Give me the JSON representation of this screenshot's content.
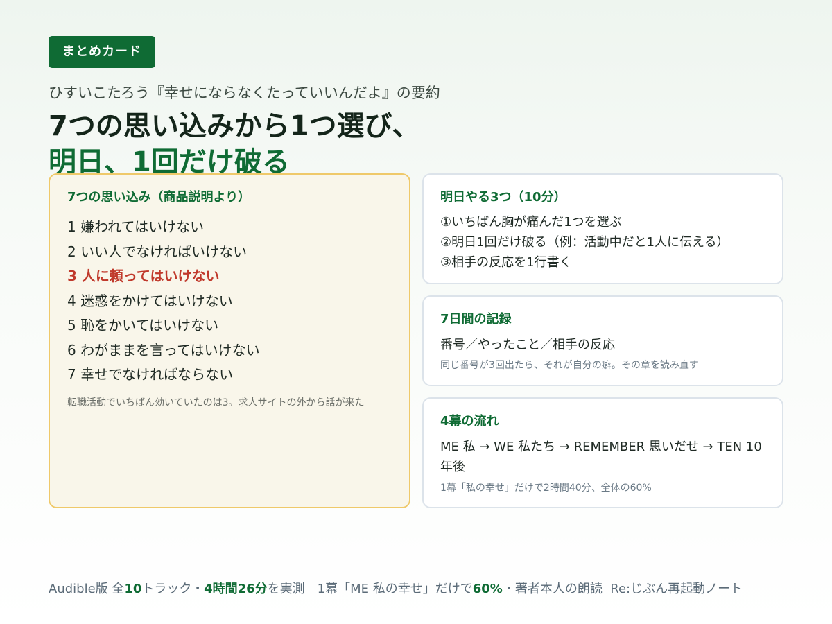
{
  "badge": "まとめカード",
  "subtitle": "ひすいこたろう『幸せにならなくたっていいんだよ』の要約",
  "title": {
    "line1": "7つの思い込みから1つ選び、",
    "line2": "明日、1回だけ破る"
  },
  "beliefs_card": {
    "heading": "7つの思い込み（商品説明より）",
    "items": [
      "1 嫌われてはいけない",
      "2 いい人でなければいけない",
      "3 人に頼ってはいけない",
      "4 迷惑をかけてはいけない",
      "5 恥をかいてはいけない",
      "6 わがままを言ってはいけない",
      "7 幸せでなければならない"
    ],
    "highlighted_item": "3 人に頼ってはいけない",
    "note": "転職活動でいちばん効いていたのは3。求人サイトの外から話が来た"
  },
  "tomorrow_card": {
    "heading": "明日やる3つ（10分）",
    "steps": [
      "①いちばん胸が痛んだ1つを選ぶ",
      "②明日1回だけ破る（例：活動中だと1人に伝える）",
      "③相手の反応を1行書く"
    ]
  },
  "record_card": {
    "heading": "7日間の記録",
    "body": "番号／やったこと／相手の反応",
    "note": "同じ番号が3回出たら、それが自分の癖。その章を読み直す"
  },
  "flow_card": {
    "heading": "4幕の流れ",
    "body": "ME 私 → WE 私たち → REMEMBER 思いだせ → TEN 10年後",
    "note": "1幕「私の幸せ」だけで2時間40分、全体の60%"
  },
  "footer": {
    "p1": "Audible版 全",
    "n1": "10",
    "p2": "トラック・",
    "n2": "4時間26分",
    "p3": "を実測｜1幕「ME 私の幸せ」だけで",
    "n3": "60%",
    "p4": "・著者本人の朗読",
    "brand": "Re:じぶん再起動ノート"
  },
  "colors": {
    "brand_green": "#0f6b34",
    "highlight_red": "#c0392b",
    "left_card_bg": "#f9f6ea",
    "left_card_border": "#efc96a",
    "right_card_border": "#dce3ea"
  }
}
